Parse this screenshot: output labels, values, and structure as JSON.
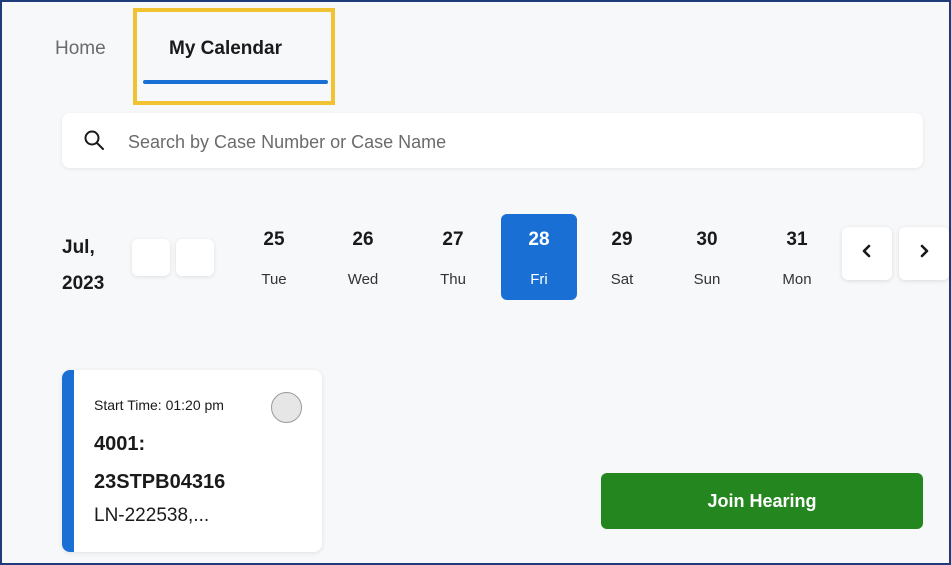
{
  "tabs": {
    "home_label": "Home",
    "calendar_label": "My Calendar"
  },
  "search": {
    "placeholder": "Search by Case Number or Case Name",
    "value": ""
  },
  "calendar": {
    "month_line1": "Jul,",
    "month_line2": "2023",
    "days": [
      {
        "num": "25",
        "weekday": "Tue"
      },
      {
        "num": "26",
        "weekday": "Wed"
      },
      {
        "num": "27",
        "weekday": "Thu"
      },
      {
        "num": "28",
        "weekday": "Fri",
        "selected": true
      },
      {
        "num": "29",
        "weekday": "Sat"
      },
      {
        "num": "30",
        "weekday": "Sun"
      },
      {
        "num": "31",
        "weekday": "Mon"
      }
    ],
    "prev_icon": "chevron-left-icon",
    "next_icon": "chevron-right-icon"
  },
  "case_card": {
    "start_time": "Start Time: 01:20 pm",
    "case_number_line1": "4001:",
    "case_number_line2": "23STPB04316",
    "case_name": "LN-222538,..."
  },
  "actions": {
    "join_label": "Join Hearing"
  },
  "colors": {
    "accent_blue": "#1a6fd4",
    "highlight_yellow": "#f1c232",
    "join_green": "#24861f",
    "frame_border": "#1f3b7a"
  }
}
